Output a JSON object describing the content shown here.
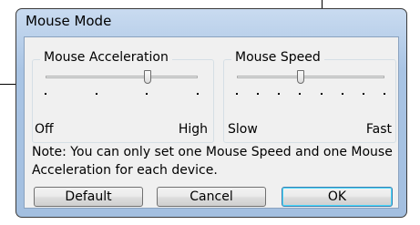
{
  "window": {
    "title": "Mouse Mode"
  },
  "acceleration": {
    "label": "Mouse Acceleration",
    "min_label": "Off",
    "max_label": "High",
    "ticks": 4,
    "level": 0.67
  },
  "speed": {
    "label": "Mouse Speed",
    "min_label": "Slow",
    "max_label": "Fast",
    "ticks": 8,
    "level": 0.43
  },
  "note": "Note: You can only set one Mouse Speed and one Mouse Acceleration for each device.",
  "buttons": {
    "default": "Default",
    "cancel": "Cancel",
    "ok": "OK"
  }
}
